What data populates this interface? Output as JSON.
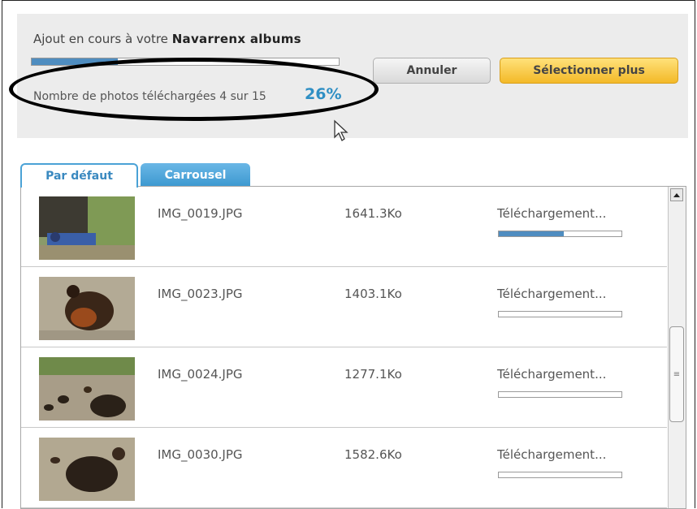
{
  "header": {
    "heading_prefix": "Ajout en cours à votre",
    "album_name": "Navarrenx albums",
    "overall_progress_fraction": 0.28,
    "count_text": "Nombre de photos téléchargées 4 sur 15",
    "percent": "26%"
  },
  "buttons": {
    "cancel_label": "Annuler",
    "select_more_label": "Sélectionner plus"
  },
  "tabs": [
    {
      "label": "Par défaut",
      "selected": true
    },
    {
      "label": "Carrousel",
      "selected": false
    }
  ],
  "files": [
    {
      "name": "IMG_0019.JPG",
      "size": "1641.3Ko",
      "status": "Téléchargement...",
      "progress": 0.53
    },
    {
      "name": "IMG_0023.JPG",
      "size": "1403.1Ko",
      "status": "Téléchargement...",
      "progress": 0
    },
    {
      "name": "IMG_0024.JPG",
      "size": "1277.1Ko",
      "status": "Téléchargement...",
      "progress": 0
    },
    {
      "name": "IMG_0030.JPG",
      "size": "1582.6Ko",
      "status": "Téléchargement...",
      "progress": 0
    }
  ],
  "colors": {
    "accent_blue": "#2f8fc4",
    "progress_fill": "#4f8dc0",
    "select_button": "#f3b928"
  },
  "icons": {
    "cursor": "mouse-pointer-icon",
    "scroll_up": "chevron-up-icon",
    "scroll_grip": "grip-icon"
  }
}
